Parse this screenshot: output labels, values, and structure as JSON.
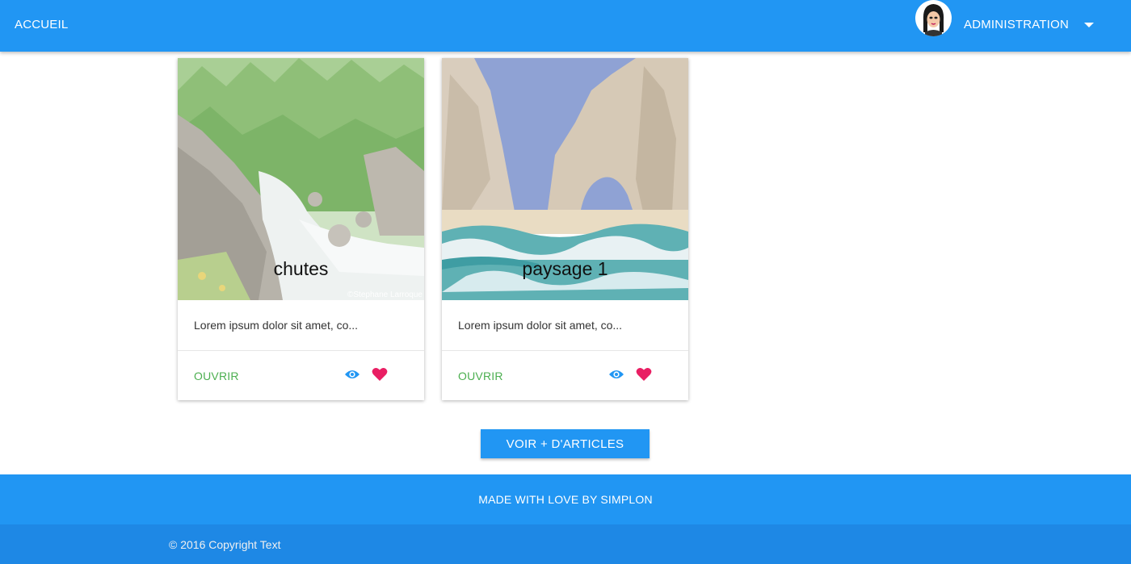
{
  "nav": {
    "home_label": "ACCUEIL",
    "admin_label": "ADMINISTRATION",
    "avatar_icon": "avatar-icon",
    "caret_icon": "caret-down-icon"
  },
  "cards": [
    {
      "title": "chutes",
      "watermark": "©Stephane Larroque",
      "excerpt": "Lorem ipsum dolor sit amet, co...",
      "open_label": "OUVRIR",
      "view_icon": "eye-icon",
      "like_icon": "heart-icon"
    },
    {
      "title": "paysage 1",
      "excerpt": "Lorem ipsum dolor sit amet, co...",
      "open_label": "OUVRIR",
      "view_icon": "eye-icon",
      "like_icon": "heart-icon"
    }
  ],
  "more_button_label": "VOIR + D'ARTICLES",
  "footer": {
    "made_with": "MADE WITH LOVE BY SIMPLON",
    "copyright": "© 2016 Copyright Text"
  },
  "colors": {
    "primary": "#2196f3",
    "footer_dark": "#1e88e5",
    "open_link": "#4caf50",
    "eye": "#2196f3",
    "heart": "#e91e63"
  }
}
